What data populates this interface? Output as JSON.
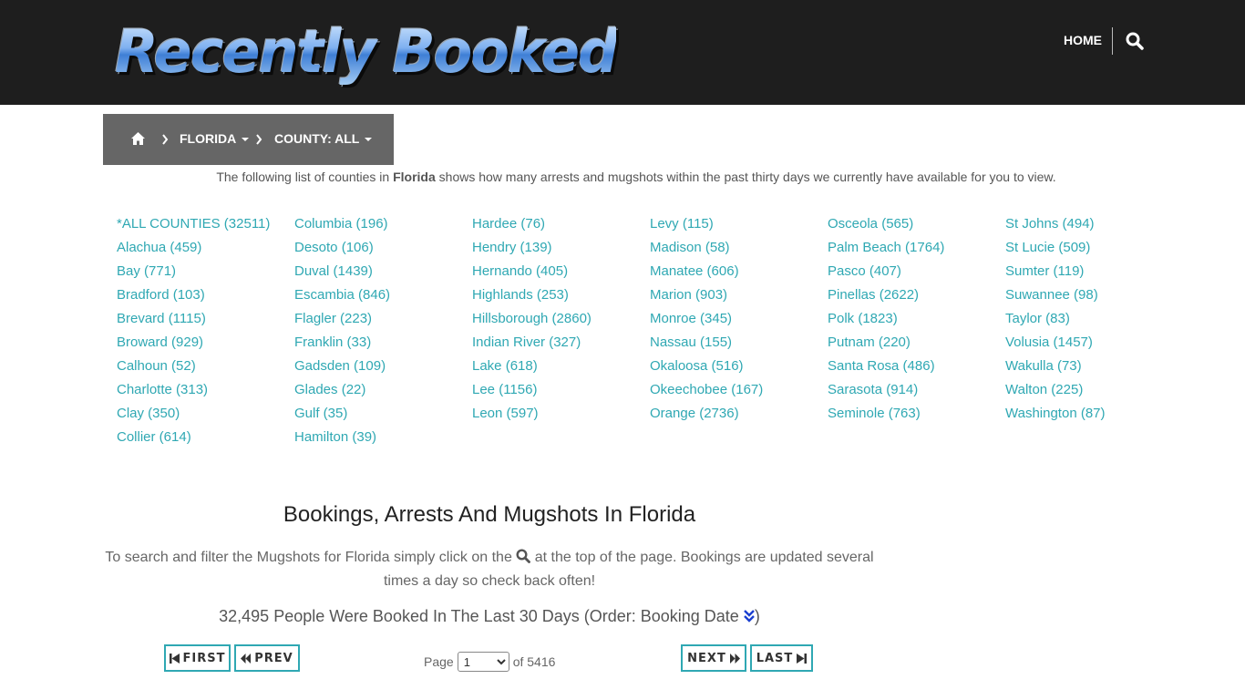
{
  "header": {
    "logo_text": "Recently Booked",
    "nav_home": "HOME"
  },
  "breadcrumb": {
    "state": "FLORIDA",
    "county": "COUNTY: ALL"
  },
  "intro": {
    "before": "The following list of counties in ",
    "state": "Florida",
    "after": " shows how many arrests and mugshots within the past thirty days we currently have available for you to view."
  },
  "counties": [
    [
      "*ALL COUNTIES (32511)",
      "Alachua (459)",
      "Bay (771)",
      "Bradford (103)",
      "Brevard (1115)",
      "Broward (929)",
      "Calhoun (52)",
      "Charlotte (313)",
      "Clay (350)",
      "Collier (614)"
    ],
    [
      "Columbia (196)",
      "Desoto (106)",
      "Duval (1439)",
      "Escambia (846)",
      "Flagler (223)",
      "Franklin (33)",
      "Gadsden (109)",
      "Glades (22)",
      "Gulf (35)",
      "Hamilton (39)"
    ],
    [
      "Hardee (76)",
      "Hendry (139)",
      "Hernando (405)",
      "Highlands (253)",
      "Hillsborough (2860)",
      "Indian River (327)",
      "Lake (618)",
      "Lee (1156)",
      "Leon (597)"
    ],
    [
      "Levy (115)",
      "Madison (58)",
      "Manatee (606)",
      "Marion (903)",
      "Monroe (345)",
      "Nassau (155)",
      "Okaloosa (516)",
      "Okeechobee (167)",
      "Orange (2736)"
    ],
    [
      "Osceola (565)",
      "Palm Beach (1764)",
      "Pasco (407)",
      "Pinellas (2622)",
      "Polk (1823)",
      "Putnam (220)",
      "Santa Rosa (486)",
      "Sarasota (914)",
      "Seminole (763)"
    ],
    [
      "St Johns (494)",
      "St Lucie (509)",
      "Sumter (119)",
      "Suwannee (98)",
      "Taylor (83)",
      "Volusia (1457)",
      "Wakulla (73)",
      "Walton (225)",
      "Washington (87)"
    ]
  ],
  "section": {
    "title": "Bookings, Arrests And Mugshots In Florida",
    "text_before": "To search and filter the Mugshots for Florida simply click on the",
    "text_after": "at the top of the page. Bookings are updated several times a day so check back often!",
    "booked_text": "32,495 People Were Booked In The Last 30 Days (Order: Booking Date",
    "booked_close": ")"
  },
  "pagination": {
    "first": "FIRST",
    "prev": "PREV",
    "next": "NEXT",
    "last": "LAST",
    "page_label": "Page",
    "current_page": "1",
    "of_text": "of 5416"
  },
  "colors": {
    "header_bg": "#1e1e1e",
    "breadcrumb_bg": "#666666",
    "link": "#2fa8b3",
    "button_border": "#2fa8b3"
  }
}
